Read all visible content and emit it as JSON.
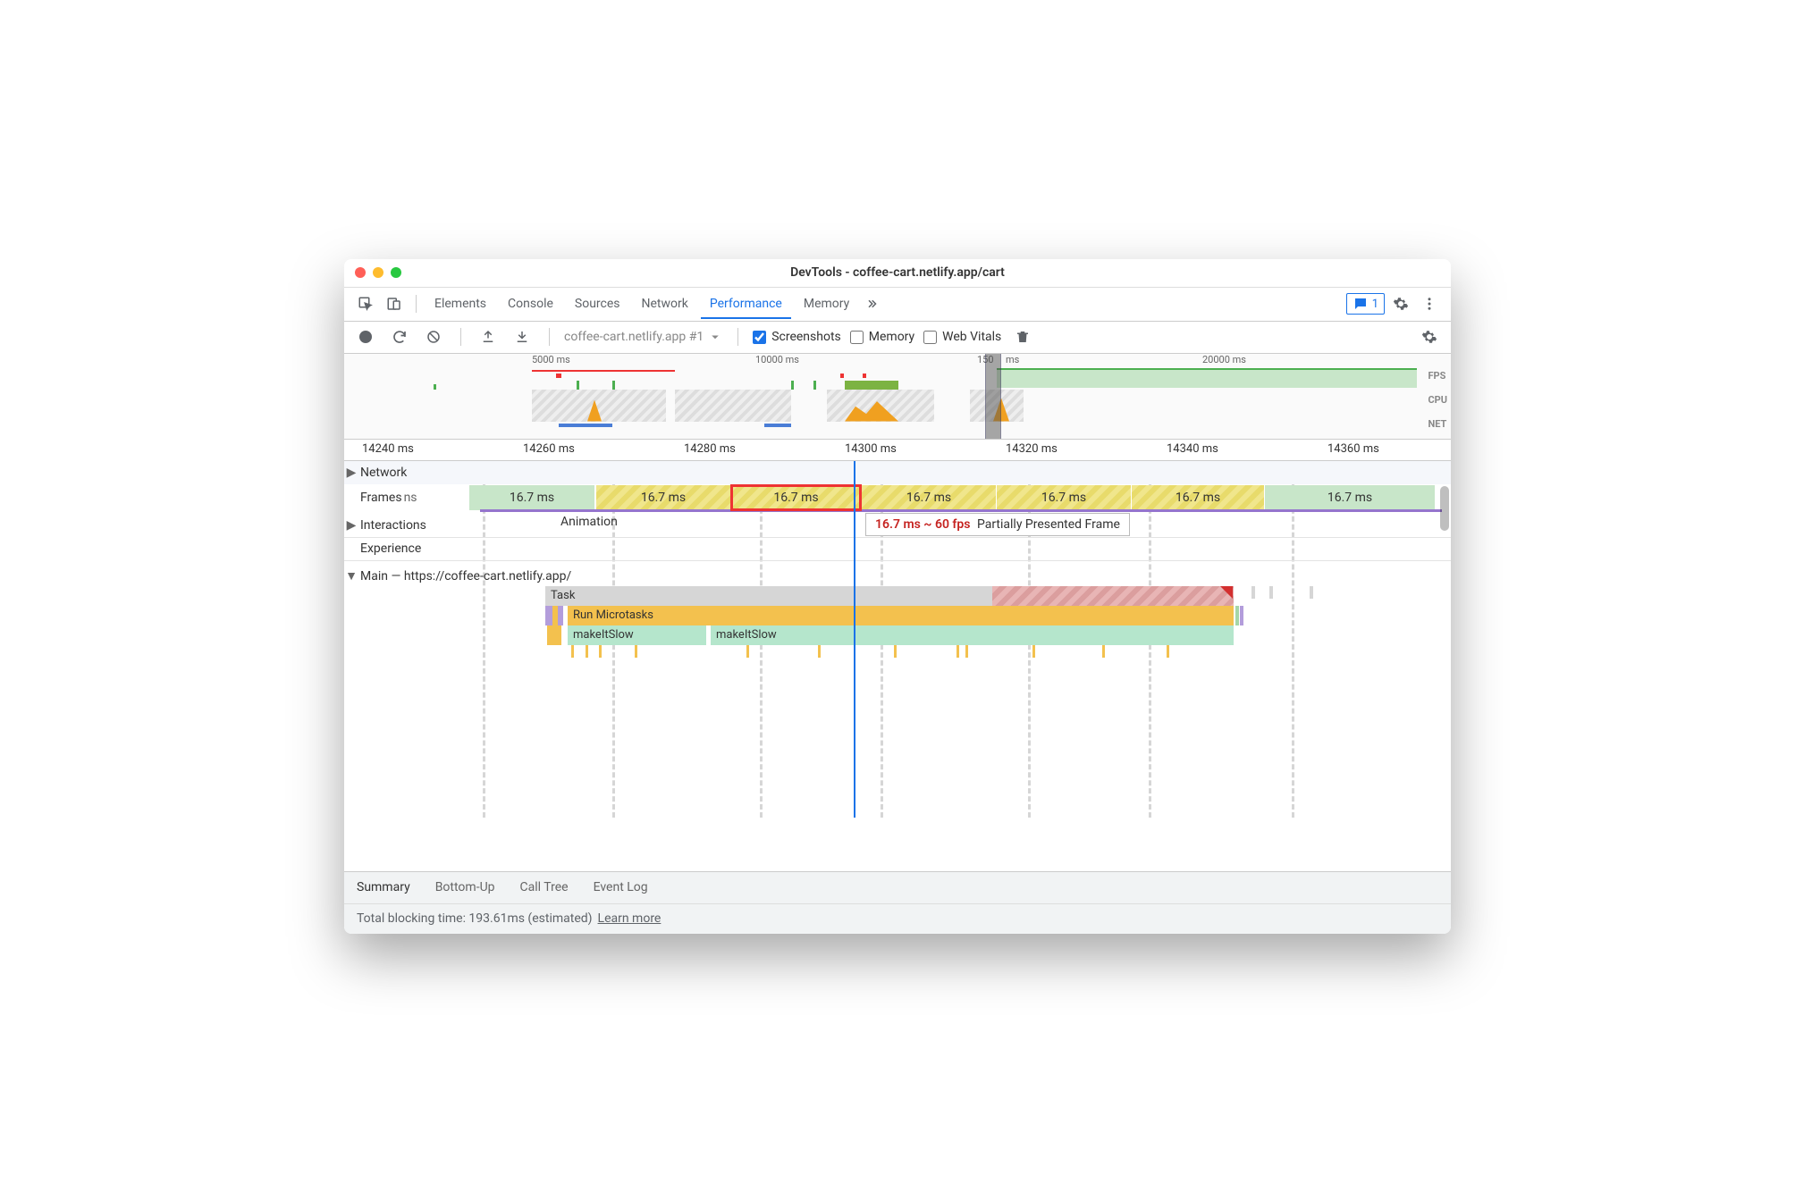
{
  "window": {
    "title": "DevTools - coffee-cart.netlify.app/cart"
  },
  "tabs": {
    "items": [
      "Elements",
      "Console",
      "Sources",
      "Network",
      "Performance",
      "Memory"
    ],
    "activeIndex": 4,
    "badgeCount": "1"
  },
  "toolbar": {
    "recordingName": "coffee-cart.netlify.app #1",
    "checks": {
      "screenshots": {
        "label": "Screenshots",
        "checked": true
      },
      "memory": {
        "label": "Memory",
        "checked": false
      },
      "webvitals": {
        "label": "Web Vitals",
        "checked": false
      }
    }
  },
  "overview": {
    "ticks": [
      "5000 ms",
      "10000 ms",
      "150",
      "ms",
      "20000 ms"
    ],
    "labels": [
      "FPS",
      "CPU",
      "NET"
    ]
  },
  "ruler": {
    "ticks": [
      "14240 ms",
      "14260 ms",
      "14280 ms",
      "14300 ms",
      "14320 ms",
      "14340 ms",
      "14360 ms"
    ]
  },
  "track_labels": {
    "network": "Network",
    "frames": "Frames",
    "frames_suffix": "ns",
    "interactions": "Interactions",
    "experience": "Experience",
    "main": "Main — https://coffee-cart.netlify.app/"
  },
  "frames": {
    "label": "16.7 ms",
    "tooltip_time": "16.7 ms ~ 60 fps",
    "tooltip_desc": "Partially Presented Frame"
  },
  "interactions": {
    "label": "Animation"
  },
  "flame": {
    "task": "Task",
    "microtasks": "Run Microtasks",
    "fn1": "makeItSlow",
    "fn2": "makeItSlow"
  },
  "bottom_tabs": [
    "Summary",
    "Bottom-Up",
    "Call Tree",
    "Event Log"
  ],
  "footer": {
    "text": "Total blocking time: 193.61ms (estimated)",
    "link": "Learn more"
  },
  "chart_data": {
    "type": "timeline",
    "overview": {
      "unit": "ms",
      "tick_values": [
        5000,
        10000,
        15000,
        20000
      ],
      "selection_range_ms": [
        14240,
        14360
      ]
    },
    "ruler_range_ms": [
      14240,
      14360
    ],
    "ruler_tick_values": [
      14240,
      14260,
      14280,
      14300,
      14320,
      14340,
      14360
    ],
    "frames": [
      {
        "duration_ms": 16.7,
        "state": "good"
      },
      {
        "duration_ms": 16.7,
        "state": "partial"
      },
      {
        "duration_ms": 16.7,
        "state": "partial",
        "selected": true
      },
      {
        "duration_ms": 16.7,
        "state": "partial"
      },
      {
        "duration_ms": 16.7,
        "state": "partial"
      },
      {
        "duration_ms": 16.7,
        "state": "partial"
      },
      {
        "duration_ms": 16.7,
        "state": "good"
      }
    ],
    "main_thread": {
      "url": "https://coffee-cart.netlify.app/",
      "rows": [
        {
          "name": "Task",
          "type": "task"
        },
        {
          "name": "Run Microtasks",
          "type": "scripting"
        },
        {
          "calls": [
            "makeItSlow",
            "makeItSlow"
          ],
          "type": "scripting"
        }
      ]
    },
    "total_blocking_time_ms": 193.61
  }
}
